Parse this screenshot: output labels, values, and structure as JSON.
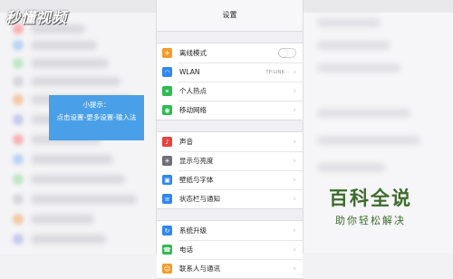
{
  "watermark": "秒懂视频",
  "tip": {
    "title": "小提示：",
    "text": "点击设置-更多设置-输入法"
  },
  "settings": {
    "title": "设置",
    "groups": [
      [
        {
          "icon": "airplane-icon",
          "label": "离线模式",
          "color": "#f39c2b",
          "toggle": "off"
        },
        {
          "icon": "wifi-icon",
          "label": "WLAN",
          "value": "TP-LINK···",
          "color": "#2f86f5"
        },
        {
          "icon": "hotspot-icon",
          "label": "个人热点",
          "color": "#2fbb55"
        },
        {
          "icon": "cellular-icon",
          "label": "移动网络",
          "color": "#2fbb55"
        }
      ],
      [
        {
          "icon": "sound-icon",
          "label": "声音",
          "color": "#e8423e"
        },
        {
          "icon": "display-icon",
          "label": "显示与亮度",
          "color": "#6f6f75"
        },
        {
          "icon": "wallpaper-icon",
          "label": "壁纸与字体",
          "color": "#2f86f5"
        },
        {
          "icon": "notification-icon",
          "label": "状态栏与通知",
          "color": "#2f86f5"
        }
      ],
      [
        {
          "icon": "update-icon",
          "label": "系统升级",
          "color": "#2f86f5"
        },
        {
          "icon": "phone-icon",
          "label": "电话",
          "color": "#2fbb55"
        },
        {
          "icon": "contacts-icon",
          "label": "联系人与通讯",
          "color": "#f39c2b"
        }
      ]
    ]
  },
  "brand": {
    "main": "百科全说",
    "sub": "助你轻松解决"
  }
}
